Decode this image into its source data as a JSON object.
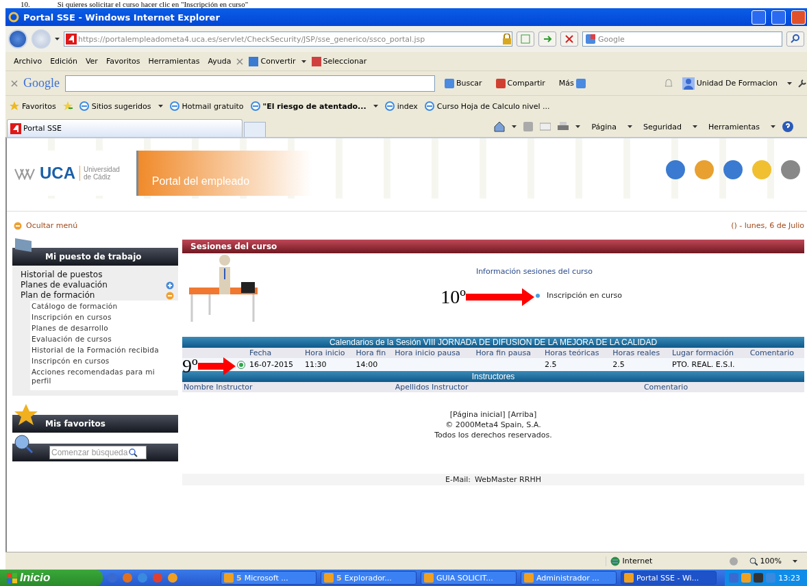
{
  "doc_caption": {
    "number": "10.",
    "text": "Si quieres solicitar el curso hacer clic en \"Inscripción en curso\""
  },
  "window": {
    "title": "Portal SSE - Windows Internet Explorer"
  },
  "address_bar": {
    "url": "https://portalempleadometa4.uca.es/servlet/CheckSecurity/JSP/sse_generico/ssco_portal.jsp"
  },
  "search_box": {
    "placeholder": "Google"
  },
  "menu_bar": {
    "items": [
      "Archivo",
      "Edición",
      "Ver",
      "Favoritos",
      "Herramientas",
      "Ayuda"
    ],
    "tools": [
      "Convertir",
      "Seleccionar"
    ]
  },
  "google_bar": {
    "logo": "Google",
    "buttons": [
      "Buscar",
      "Compartir",
      "Más"
    ],
    "account": "Unidad De Formacion"
  },
  "favorites_bar": {
    "label": "Favoritos",
    "items": [
      {
        "label": "Sitios sugeridos",
        "bold": false,
        "dropdown": true
      },
      {
        "label": "Hotmail gratuito",
        "bold": false,
        "dropdown": false
      },
      {
        "label": "\"El riesgo de atentado...",
        "bold": true,
        "dropdown": true
      },
      {
        "label": "index",
        "bold": false,
        "dropdown": false
      },
      {
        "label": "Curso Hoja de Calculo nivel ...",
        "bold": false,
        "dropdown": false
      }
    ]
  },
  "tabs": [
    {
      "label": "Portal SSE",
      "selected": true
    }
  ],
  "command_bar": [
    "Página",
    "Seguridad",
    "Herramientas"
  ],
  "portal_header": {
    "logo": "UCA",
    "university": [
      "Universidad",
      "de Cádiz"
    ],
    "title": "Portal del empleado"
  },
  "hide_menu": "Ocultar menú",
  "date": "() - lunes, 6 de Julio",
  "sidebar": {
    "title": "Mi puesto de trabajo",
    "items": [
      {
        "label": "Historial de puestos"
      },
      {
        "label": "Planes de evaluación",
        "expanded": false
      },
      {
        "label": "Plan de formación",
        "expanded": true,
        "children": [
          {
            "label": "Catálogo de formación"
          },
          {
            "label": "Inscripción en cursos"
          },
          {
            "label": "Planes de desarrollo"
          },
          {
            "label": "Evaluación de cursos"
          },
          {
            "label": "Historial de la Formación recibida"
          },
          {
            "label": "Inscripcón en cursos"
          },
          {
            "label": "Acciones recomendadas para mi perfil"
          }
        ]
      }
    ],
    "favorites_title": "Mis favoritos",
    "search_placeholder": "Comenzar búsqueda"
  },
  "main": {
    "title": "Sesiones del curso",
    "info_link": "Información sesiones del curso",
    "action_link": "Inscripción en curso"
  },
  "annotations": [
    {
      "label": "10º"
    },
    {
      "label": "9º"
    }
  ],
  "sessions_table": {
    "caption": "Calendarios de la Sesión VIII JORNADA DE DIFUSION DE LA MEJORA DE LA CALIDAD",
    "columns": [
      "Fecha",
      "Hora inicio",
      "Hora fin",
      "Hora inicio pausa",
      "Hora fin pausa",
      "Horas teóricas",
      "Horas reales",
      "Lugar formación",
      "Comentario"
    ],
    "rows": [
      {
        "selected": true,
        "cells": [
          "16-07-2015",
          "11:30",
          "14:00",
          "",
          "",
          "2.5",
          "2.5",
          "PTO. REAL. E.S.I.",
          ""
        ]
      }
    ]
  },
  "instructors_table": {
    "caption": "Instructores",
    "columns": [
      "Nombre Instructor",
      "Apellidos Instructor",
      "Comentario"
    ]
  },
  "footer": {
    "links": [
      "[Página inicial]",
      "[Arriba]"
    ],
    "copyright": "© 2000Meta4 Spain, S.A.",
    "rights": "Todos los derechos reservados.",
    "email_label": "E-Mail:",
    "email_link": "WebMaster  RRHH"
  },
  "status_bar": {
    "zone": "Internet",
    "zoom": "100%"
  },
  "taskbar": {
    "start": "Inicio",
    "tasks": [
      {
        "count": "5",
        "label": "Microsoft ...",
        "selected": false
      },
      {
        "count": "5",
        "label": "Explorador...",
        "selected": false
      },
      {
        "label": "GUIA SOLICIT...",
        "selected": false
      },
      {
        "label": "Administrador ...",
        "selected": false
      },
      {
        "label": "Portal SSE - Wi...",
        "selected": true
      }
    ],
    "clock": "13:23"
  }
}
